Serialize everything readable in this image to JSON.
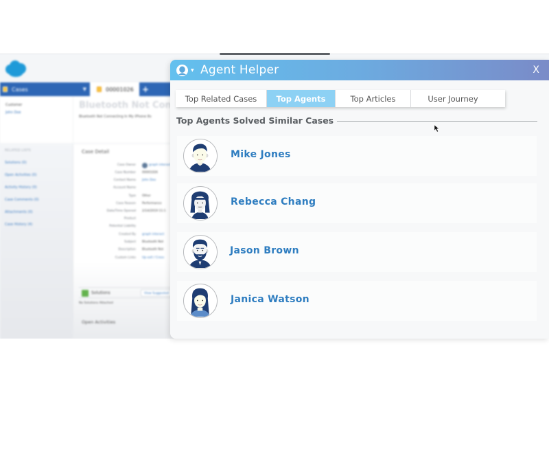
{
  "background_app": {
    "nav": {
      "cases_tab_label": "Cases",
      "case_tab_label": "00001026",
      "add_tab_label": "+"
    },
    "customer": {
      "label": "Customer",
      "name": "John Doe"
    },
    "case_header": {
      "title": "Bluetooth Not Connecting",
      "subtitle": "Bluetooth Not Connecting In My iPhone 8s"
    },
    "related_lists": {
      "heading": "RELATED LISTS",
      "items": [
        "Solutions (0)",
        "Open Activities (0)",
        "Activity History (0)",
        "Case Comments (0)",
        "Attachments (0)",
        "Case History (4)"
      ]
    },
    "case_detail": {
      "heading": "Case Detail",
      "fields": [
        {
          "label": "Case Owner",
          "value": "graph interact",
          "link": true
        },
        {
          "label": "Case Number",
          "value": "00001026",
          "link": false
        },
        {
          "label": "Contact Name",
          "value": "John Doe",
          "link": true
        },
        {
          "label": "Account Name",
          "value": "",
          "link": false
        },
        {
          "label": "Type",
          "value": "Other",
          "link": false
        },
        {
          "label": "Case Reason",
          "value": "Performance",
          "link": false
        },
        {
          "label": "Date/Time Opened",
          "value": "2/14/2019 11:1",
          "link": false
        },
        {
          "label": "Product",
          "value": "",
          "link": false
        },
        {
          "label": "Potential Liability",
          "value": "",
          "link": false
        },
        {
          "label": "Created By",
          "value": "graph interact",
          "link": true
        },
        {
          "label": "Subject",
          "value": "Bluetooth Not",
          "link": false
        },
        {
          "label": "Description",
          "value": "Bluetooth Not",
          "link": false
        },
        {
          "label": "Custom Links",
          "value": "Up-sell / Cross",
          "link": true
        }
      ]
    },
    "solutions": {
      "label": "Solutions",
      "view_suggested_label": "View Suggested",
      "empty_text": "No Solutions Attached"
    },
    "open_activities_label": "Open Activities"
  },
  "agent_helper": {
    "title": "Agent Helper",
    "close_label": "X",
    "tabs": [
      {
        "label": "Top Related Cases",
        "active": false
      },
      {
        "label": "Top Agents",
        "active": true
      },
      {
        "label": "Top Articles",
        "active": false
      },
      {
        "label": "User Journey",
        "active": false
      }
    ],
    "section_heading": "Top Agents Solved Similar Cases",
    "agents": [
      {
        "name": "Mike Jones",
        "avatar": "male-agent-avatar"
      },
      {
        "name": "Rebecca Chang",
        "avatar": "female-agent-avatar"
      },
      {
        "name": "Jason Brown",
        "avatar": "bearded-male-agent-avatar"
      },
      {
        "name": "Janica Watson",
        "avatar": "female-agent-avatar-long-hair"
      }
    ],
    "colors": {
      "header_gradient_start": "#63c0ee",
      "header_gradient_end": "#7a8bc8",
      "active_tab": "#8dd1f4",
      "agent_name": "#2e7dc0"
    }
  }
}
